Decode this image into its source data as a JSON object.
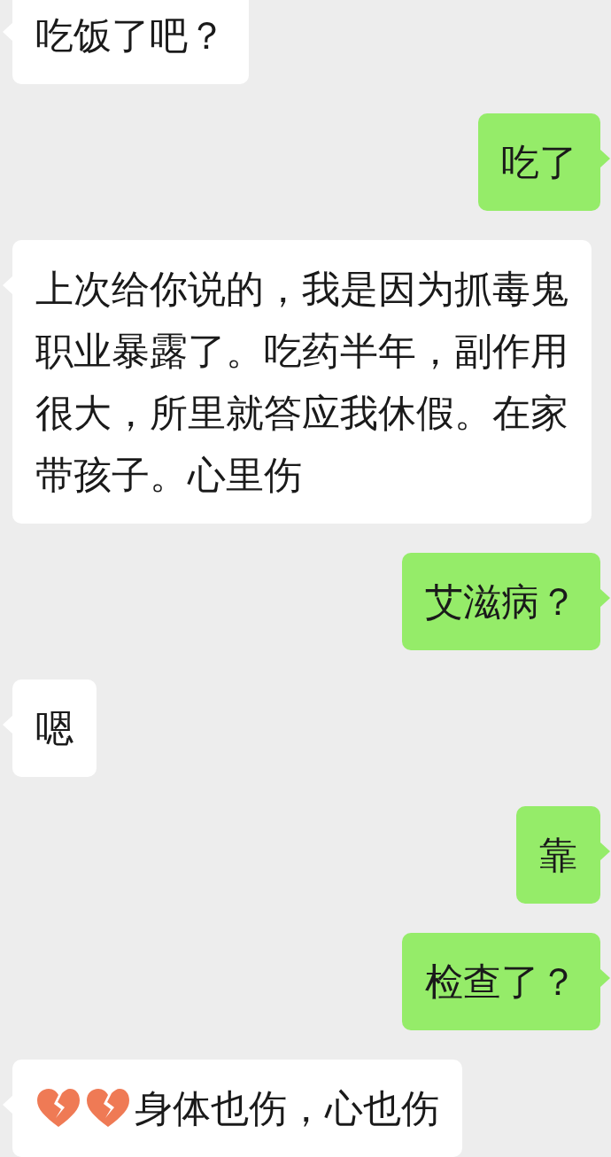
{
  "messages": [
    {
      "outgoing": false,
      "lines": [
        "吃饭了吧？"
      ]
    },
    {
      "outgoing": true,
      "lines": [
        "吃了"
      ]
    },
    {
      "outgoing": false,
      "lines": [
        "上次给你说的，我是因为抓毒鬼",
        "职业暴露了。吃药半年，副作用",
        "很大，所里就答应我休假。在家",
        "带孩子。心里伤"
      ]
    },
    {
      "outgoing": true,
      "lines": [
        "艾滋病？"
      ]
    },
    {
      "outgoing": false,
      "lines": [
        "嗯"
      ]
    },
    {
      "outgoing": true,
      "lines": [
        "靠"
      ]
    },
    {
      "outgoing": true,
      "lines": [
        "检查了？"
      ]
    },
    {
      "outgoing": false,
      "segments": [
        {
          "kind": "icon"
        },
        {
          "kind": "icon"
        },
        {
          "kind": "text",
          "text": "身体也伤，心也伤"
        }
      ]
    }
  ]
}
